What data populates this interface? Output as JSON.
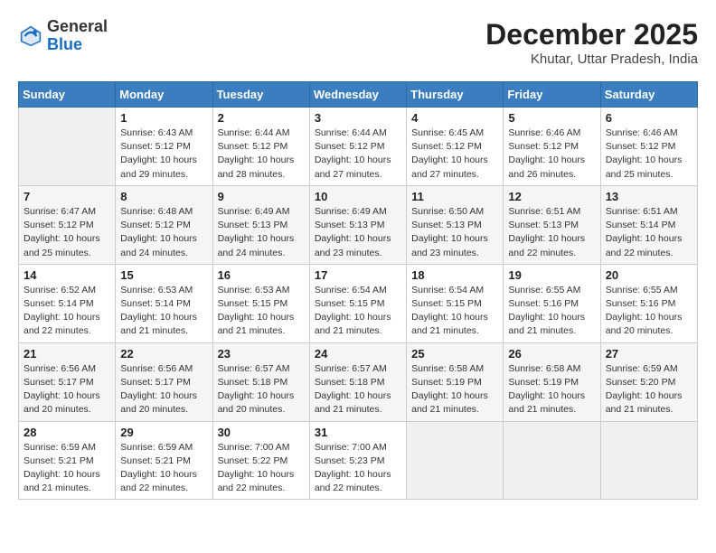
{
  "header": {
    "logo_general": "General",
    "logo_blue": "Blue",
    "month": "December 2025",
    "location": "Khutar, Uttar Pradesh, India"
  },
  "days_of_week": [
    "Sunday",
    "Monday",
    "Tuesday",
    "Wednesday",
    "Thursday",
    "Friday",
    "Saturday"
  ],
  "weeks": [
    [
      {
        "day": "",
        "info": ""
      },
      {
        "day": "1",
        "info": "Sunrise: 6:43 AM\nSunset: 5:12 PM\nDaylight: 10 hours\nand 29 minutes."
      },
      {
        "day": "2",
        "info": "Sunrise: 6:44 AM\nSunset: 5:12 PM\nDaylight: 10 hours\nand 28 minutes."
      },
      {
        "day": "3",
        "info": "Sunrise: 6:44 AM\nSunset: 5:12 PM\nDaylight: 10 hours\nand 27 minutes."
      },
      {
        "day": "4",
        "info": "Sunrise: 6:45 AM\nSunset: 5:12 PM\nDaylight: 10 hours\nand 27 minutes."
      },
      {
        "day": "5",
        "info": "Sunrise: 6:46 AM\nSunset: 5:12 PM\nDaylight: 10 hours\nand 26 minutes."
      },
      {
        "day": "6",
        "info": "Sunrise: 6:46 AM\nSunset: 5:12 PM\nDaylight: 10 hours\nand 25 minutes."
      }
    ],
    [
      {
        "day": "7",
        "info": "Sunrise: 6:47 AM\nSunset: 5:12 PM\nDaylight: 10 hours\nand 25 minutes."
      },
      {
        "day": "8",
        "info": "Sunrise: 6:48 AM\nSunset: 5:12 PM\nDaylight: 10 hours\nand 24 minutes."
      },
      {
        "day": "9",
        "info": "Sunrise: 6:49 AM\nSunset: 5:13 PM\nDaylight: 10 hours\nand 24 minutes."
      },
      {
        "day": "10",
        "info": "Sunrise: 6:49 AM\nSunset: 5:13 PM\nDaylight: 10 hours\nand 23 minutes."
      },
      {
        "day": "11",
        "info": "Sunrise: 6:50 AM\nSunset: 5:13 PM\nDaylight: 10 hours\nand 23 minutes."
      },
      {
        "day": "12",
        "info": "Sunrise: 6:51 AM\nSunset: 5:13 PM\nDaylight: 10 hours\nand 22 minutes."
      },
      {
        "day": "13",
        "info": "Sunrise: 6:51 AM\nSunset: 5:14 PM\nDaylight: 10 hours\nand 22 minutes."
      }
    ],
    [
      {
        "day": "14",
        "info": "Sunrise: 6:52 AM\nSunset: 5:14 PM\nDaylight: 10 hours\nand 22 minutes."
      },
      {
        "day": "15",
        "info": "Sunrise: 6:53 AM\nSunset: 5:14 PM\nDaylight: 10 hours\nand 21 minutes."
      },
      {
        "day": "16",
        "info": "Sunrise: 6:53 AM\nSunset: 5:15 PM\nDaylight: 10 hours\nand 21 minutes."
      },
      {
        "day": "17",
        "info": "Sunrise: 6:54 AM\nSunset: 5:15 PM\nDaylight: 10 hours\nand 21 minutes."
      },
      {
        "day": "18",
        "info": "Sunrise: 6:54 AM\nSunset: 5:15 PM\nDaylight: 10 hours\nand 21 minutes."
      },
      {
        "day": "19",
        "info": "Sunrise: 6:55 AM\nSunset: 5:16 PM\nDaylight: 10 hours\nand 21 minutes."
      },
      {
        "day": "20",
        "info": "Sunrise: 6:55 AM\nSunset: 5:16 PM\nDaylight: 10 hours\nand 20 minutes."
      }
    ],
    [
      {
        "day": "21",
        "info": "Sunrise: 6:56 AM\nSunset: 5:17 PM\nDaylight: 10 hours\nand 20 minutes."
      },
      {
        "day": "22",
        "info": "Sunrise: 6:56 AM\nSunset: 5:17 PM\nDaylight: 10 hours\nand 20 minutes."
      },
      {
        "day": "23",
        "info": "Sunrise: 6:57 AM\nSunset: 5:18 PM\nDaylight: 10 hours\nand 20 minutes."
      },
      {
        "day": "24",
        "info": "Sunrise: 6:57 AM\nSunset: 5:18 PM\nDaylight: 10 hours\nand 21 minutes."
      },
      {
        "day": "25",
        "info": "Sunrise: 6:58 AM\nSunset: 5:19 PM\nDaylight: 10 hours\nand 21 minutes."
      },
      {
        "day": "26",
        "info": "Sunrise: 6:58 AM\nSunset: 5:19 PM\nDaylight: 10 hours\nand 21 minutes."
      },
      {
        "day": "27",
        "info": "Sunrise: 6:59 AM\nSunset: 5:20 PM\nDaylight: 10 hours\nand 21 minutes."
      }
    ],
    [
      {
        "day": "28",
        "info": "Sunrise: 6:59 AM\nSunset: 5:21 PM\nDaylight: 10 hours\nand 21 minutes."
      },
      {
        "day": "29",
        "info": "Sunrise: 6:59 AM\nSunset: 5:21 PM\nDaylight: 10 hours\nand 22 minutes."
      },
      {
        "day": "30",
        "info": "Sunrise: 7:00 AM\nSunset: 5:22 PM\nDaylight: 10 hours\nand 22 minutes."
      },
      {
        "day": "31",
        "info": "Sunrise: 7:00 AM\nSunset: 5:23 PM\nDaylight: 10 hours\nand 22 minutes."
      },
      {
        "day": "",
        "info": ""
      },
      {
        "day": "",
        "info": ""
      },
      {
        "day": "",
        "info": ""
      }
    ]
  ]
}
